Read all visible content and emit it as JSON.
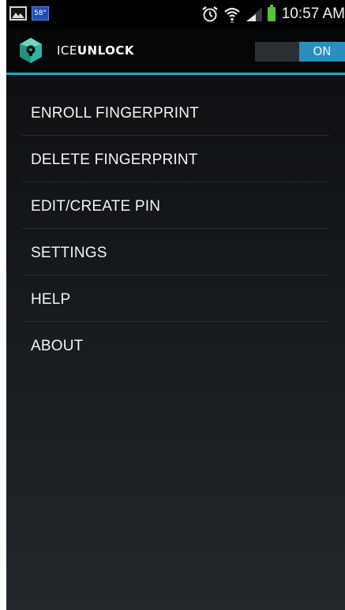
{
  "status_bar": {
    "weather_temp": "58°",
    "time": "10:57 AM",
    "icons": [
      "gallery-icon",
      "weather-icon",
      "alarm-icon",
      "wifi-icon",
      "signal-icon",
      "battery-icon"
    ]
  },
  "app_bar": {
    "title_light": "ICE",
    "title_bold": "UNLOCK",
    "toggle_label": "ON",
    "accent_color": "#2aa7c9"
  },
  "menu": {
    "items": [
      {
        "label": "ENROLL FINGERPRINT"
      },
      {
        "label": "DELETE FINGERPRINT"
      },
      {
        "label": "EDIT/CREATE PIN"
      },
      {
        "label": "SETTINGS"
      },
      {
        "label": "HELP"
      },
      {
        "label": "ABOUT"
      }
    ]
  }
}
